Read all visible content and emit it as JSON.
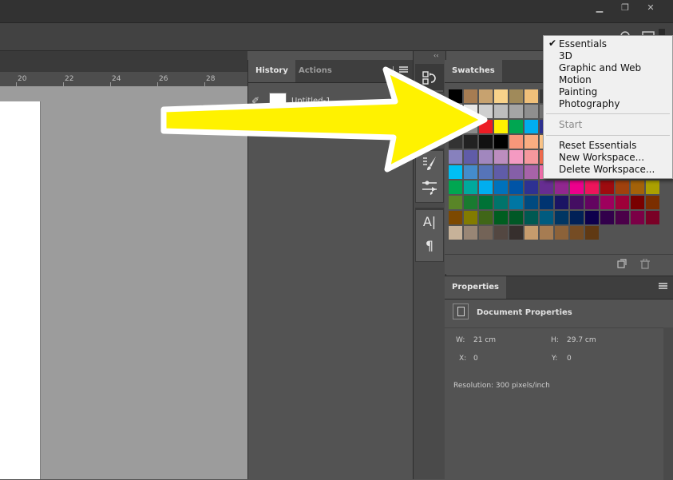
{
  "window": {
    "controls": {
      "minimize": "▁",
      "restore": "❐",
      "close": "✕"
    }
  },
  "ruler": {
    "ticks": [
      "20",
      "22",
      "24",
      "26",
      "28"
    ]
  },
  "history_panel": {
    "tabs": [
      {
        "label": "History",
        "active": true
      },
      {
        "label": "Actions",
        "active": false
      }
    ],
    "snapshot_label": "Untitled-1"
  },
  "toolstrip": {
    "collapse_glyph": "‹‹",
    "tools": [
      {
        "name": "history-tool",
        "icon": "history-brush-icon",
        "glyph": "⎌"
      },
      {
        "name": "brush-presets",
        "icon": "brush-presets-icon",
        "glyph": "✎"
      },
      {
        "name": "brush-settings",
        "icon": "brush-settings-icon",
        "glyph": "⚟"
      },
      {
        "name": "character",
        "icon": "character-icon",
        "glyph": "A|"
      },
      {
        "name": "paragraph",
        "icon": "paragraph-icon",
        "glyph": "¶"
      }
    ]
  },
  "swatches_panel": {
    "title": "Swatches",
    "rows": [
      [
        "#000000",
        "#a67c52",
        "#c7a26f",
        "#f8d28a",
        "#a08a5a",
        "#f0c07a",
        "#3a3a3a",
        "#535353",
        "#535353",
        "#535353",
        "#535353",
        "#535353",
        "#535353",
        "#535353"
      ],
      [
        "#ffffff",
        "#e8e8e8",
        "#cfcfcf",
        "#bdbdbd",
        "#a5a5a5",
        "#8f8f8f",
        "#727272",
        "#535353",
        "#535353",
        "#535353",
        "#535353",
        "#535353",
        "#535353",
        "#535353"
      ],
      [
        "#a6a6a6",
        "#8a8a8a",
        "#ed1c24",
        "#fff200",
        "#00a651",
        "#00aeef",
        "#2e3192",
        "#ec008c",
        "#ffffff",
        "#d0d0d0",
        "#b0b0b0",
        "#909090",
        "#707070",
        "#505050"
      ],
      [
        "#333333",
        "#222222",
        "#111111",
        "#000000",
        "#f7977a",
        "#f9ad81",
        "#fdc68a",
        "#fff79a",
        "#c4df9b",
        "#a2d39c",
        "#82ca9d",
        "#7bcdc8",
        "#6ecff6",
        "#7ea7d8"
      ],
      [
        "#8781bd",
        "#605ca8",
        "#a187be",
        "#bc8dbf",
        "#f49ac2",
        "#f6989d",
        "#f26c4f",
        "#f68e56",
        "#fbaf5d",
        "#fff568",
        "#acd373",
        "#7cc576",
        "#3bb878",
        "#1abbb4"
      ],
      [
        "#00bff3",
        "#448ccb",
        "#5674b9",
        "#605ca8",
        "#855fa8",
        "#a763a8",
        "#f06eaa",
        "#ed145b",
        "#ed1c24",
        "#f26522",
        "#f7941d",
        "#fff200",
        "#8dc63f",
        "#39b54a"
      ],
      [
        "#00a651",
        "#00a99d",
        "#00aeef",
        "#0072bc",
        "#0054a6",
        "#2e3192",
        "#662d91",
        "#92278f",
        "#ec008c",
        "#ed145b",
        "#9e0b0f",
        "#a0410d",
        "#a36209",
        "#aba000"
      ],
      [
        "#598527",
        "#197b30",
        "#007236",
        "#00746b",
        "#0076a3",
        "#004a80",
        "#003471",
        "#1b1464",
        "#440e62",
        "#630460",
        "#9e005d",
        "#9e0039",
        "#790000",
        "#7b2e00"
      ],
      [
        "#7d4900",
        "#827b00",
        "#406618",
        "#005e20",
        "#005826",
        "#005952",
        "#005b7f",
        "#003663",
        "#002157",
        "#0d004c",
        "#32004b",
        "#4b0049",
        "#7b0046",
        "#7a0026"
      ],
      [
        "#c7b299",
        "#998675",
        "#736357",
        "#534741",
        "#362f2d",
        "#c69c6d",
        "#a67c52",
        "#8c6239",
        "#754c24",
        "#603913",
        "#535353",
        "#535353",
        "#535353",
        "#535353"
      ]
    ]
  },
  "properties_panel": {
    "title": "Properties",
    "subtitle": "Document Properties",
    "width_label": "W:",
    "width_value": "21 cm",
    "height_label": "H:",
    "height_value": "29.7 cm",
    "x_label": "X:",
    "x_value": "0",
    "y_label": "Y:",
    "y_value": "0",
    "resolution": "Resolution: 300 pixels/inch"
  },
  "workspace_menu": {
    "check": "✔",
    "items": [
      {
        "label": "Essentials",
        "checked": true
      },
      {
        "label": "3D"
      },
      {
        "label": "Graphic and Web"
      },
      {
        "label": "Motion"
      },
      {
        "label": "Painting"
      },
      {
        "label": "Photography"
      }
    ],
    "start_label": "Start",
    "actions": [
      "Reset Essentials",
      "New Workspace...",
      "Delete Workspace..."
    ]
  },
  "colors": {
    "arrow_fill": "#fff200",
    "arrow_outline": "#ffffff",
    "ui_dark": "#323232",
    "panel": "#535353"
  }
}
